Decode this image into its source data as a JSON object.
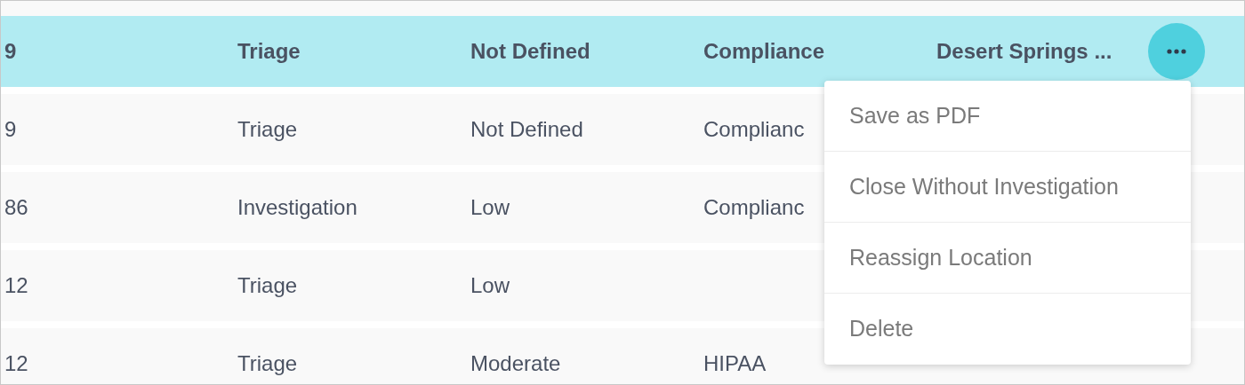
{
  "table": {
    "rows": [
      {
        "selected": true,
        "cells": [
          "9",
          "Triage",
          "Not Defined",
          "Compliance",
          "Desert Springs ..."
        ]
      },
      {
        "selected": false,
        "cells": [
          "9",
          "Triage",
          "Not Defined",
          "Complianc"
        ]
      },
      {
        "selected": false,
        "cells": [
          "86",
          "Investigation",
          "Low",
          "Complianc"
        ]
      },
      {
        "selected": false,
        "cells": [
          "12",
          "Triage",
          "Low"
        ]
      },
      {
        "selected": false,
        "cells": [
          "12",
          "Triage",
          "Moderate",
          "HIPAA"
        ]
      }
    ]
  },
  "row_menu": {
    "items": [
      "Save as PDF",
      "Close Without Investigation",
      "Reassign Location",
      "Delete"
    ]
  }
}
